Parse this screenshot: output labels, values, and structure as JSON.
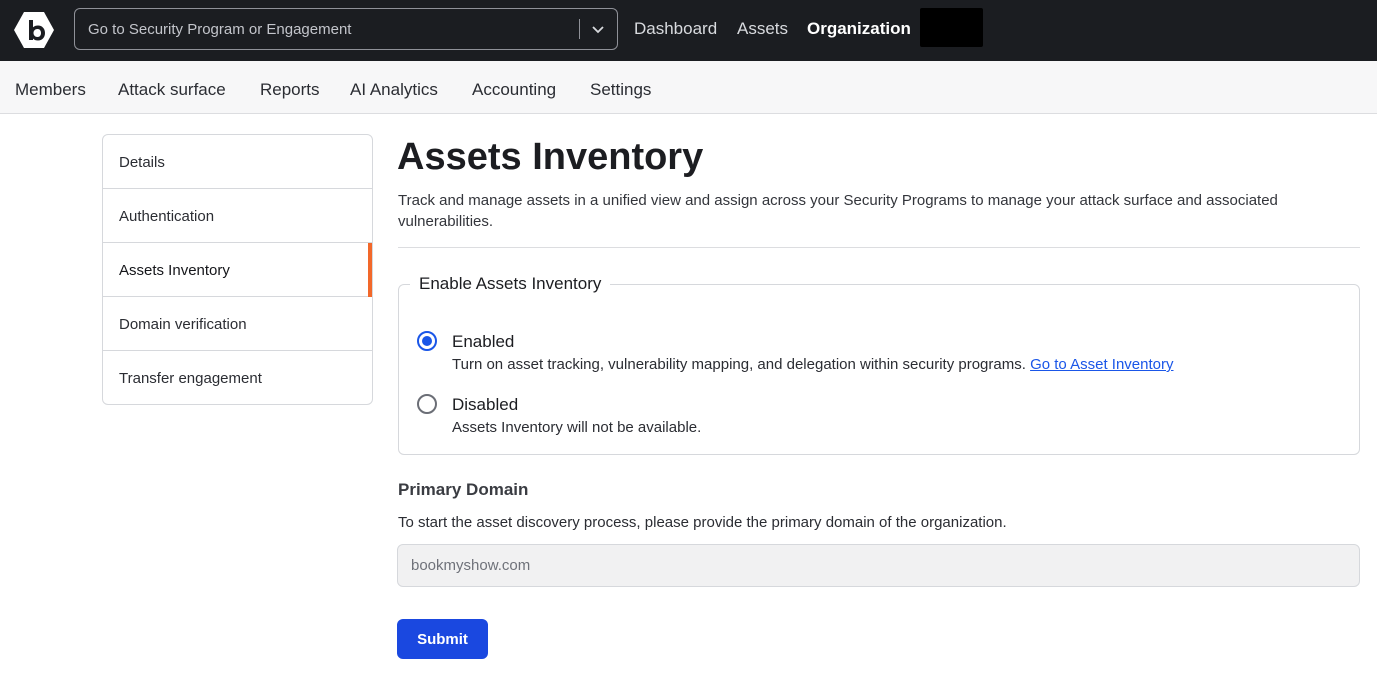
{
  "header": {
    "search_placeholder": "Go to Security Program or Engagement",
    "nav": [
      {
        "label": "Dashboard"
      },
      {
        "label": "Assets"
      },
      {
        "label": "Organization"
      }
    ]
  },
  "subnav": {
    "items": [
      {
        "label": "Members"
      },
      {
        "label": "Attack surface"
      },
      {
        "label": "Reports"
      },
      {
        "label": "AI Analytics"
      },
      {
        "label": "Accounting"
      },
      {
        "label": "Settings"
      }
    ]
  },
  "sidebar": {
    "items": [
      {
        "label": "Details"
      },
      {
        "label": "Authentication"
      },
      {
        "label": "Assets Inventory"
      },
      {
        "label": "Domain verification"
      },
      {
        "label": "Transfer engagement"
      }
    ]
  },
  "main": {
    "title": "Assets Inventory",
    "description": "Track and manage assets in a unified view and assign across your Security Programs to manage your attack surface and associated vulnerabilities.",
    "fieldset_legend": "Enable Assets Inventory",
    "options": [
      {
        "label": "Enabled",
        "help": "Turn on asset tracking, vulnerability mapping, and delegation within security programs.",
        "link": "Go to Asset Inventory"
      },
      {
        "label": "Disabled",
        "help": "Assets Inventory will not be available."
      }
    ],
    "primary_domain": {
      "label": "Primary Domain",
      "help": "To start the asset discovery process, please provide the primary domain of the organization.",
      "value": "bookmyshow.com"
    },
    "submit_label": "Submit"
  },
  "colors": {
    "topbar": "#1b1d21",
    "accent": "#1a56e8",
    "active_indicator": "#f2682a"
  }
}
